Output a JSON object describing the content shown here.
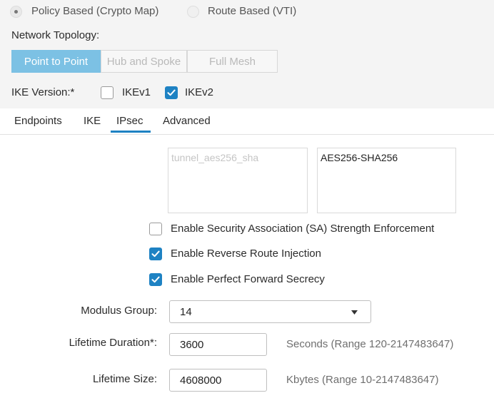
{
  "vpn_type": {
    "policy_based_label": "Policy Based (Crypto Map)",
    "route_based_label": "Route Based (VTI)",
    "selected": "policy_based"
  },
  "topology": {
    "label": "Network Topology:",
    "options": [
      "Point to Point",
      "Hub and Spoke",
      "Full Mesh"
    ],
    "selected": "Point to Point"
  },
  "ike_version": {
    "label": "IKE Version:*",
    "ikev1_label": "IKEv1",
    "ikev1_checked": false,
    "ikev2_label": "IKEv2",
    "ikev2_checked": true
  },
  "tabs": {
    "items": [
      "Endpoints",
      "IKE",
      "IPsec",
      "Advanced"
    ],
    "active": "IPsec"
  },
  "proposals": {
    "available": [
      "tunnel_aes256_sha"
    ],
    "selected": [
      "AES256-SHA256"
    ]
  },
  "options": {
    "sa_strength_label": "Enable Security Association (SA) Strength Enforcement",
    "sa_strength_checked": false,
    "rri_label": "Enable Reverse Route Injection",
    "rri_checked": true,
    "pfs_label": "Enable Perfect Forward Secrecy",
    "pfs_checked": true
  },
  "modulus_group": {
    "label": "Modulus Group:",
    "value": "14"
  },
  "lifetime_duration": {
    "label": "Lifetime Duration*:",
    "value": "3600",
    "hint": "Seconds (Range 120-2147483647)"
  },
  "lifetime_size": {
    "label": "Lifetime Size:",
    "value": "4608000",
    "hint": "Kbytes (Range 10-2147483647)"
  },
  "colors": {
    "accent": "#1e82c3",
    "segment_active": "#7cc1e4"
  }
}
